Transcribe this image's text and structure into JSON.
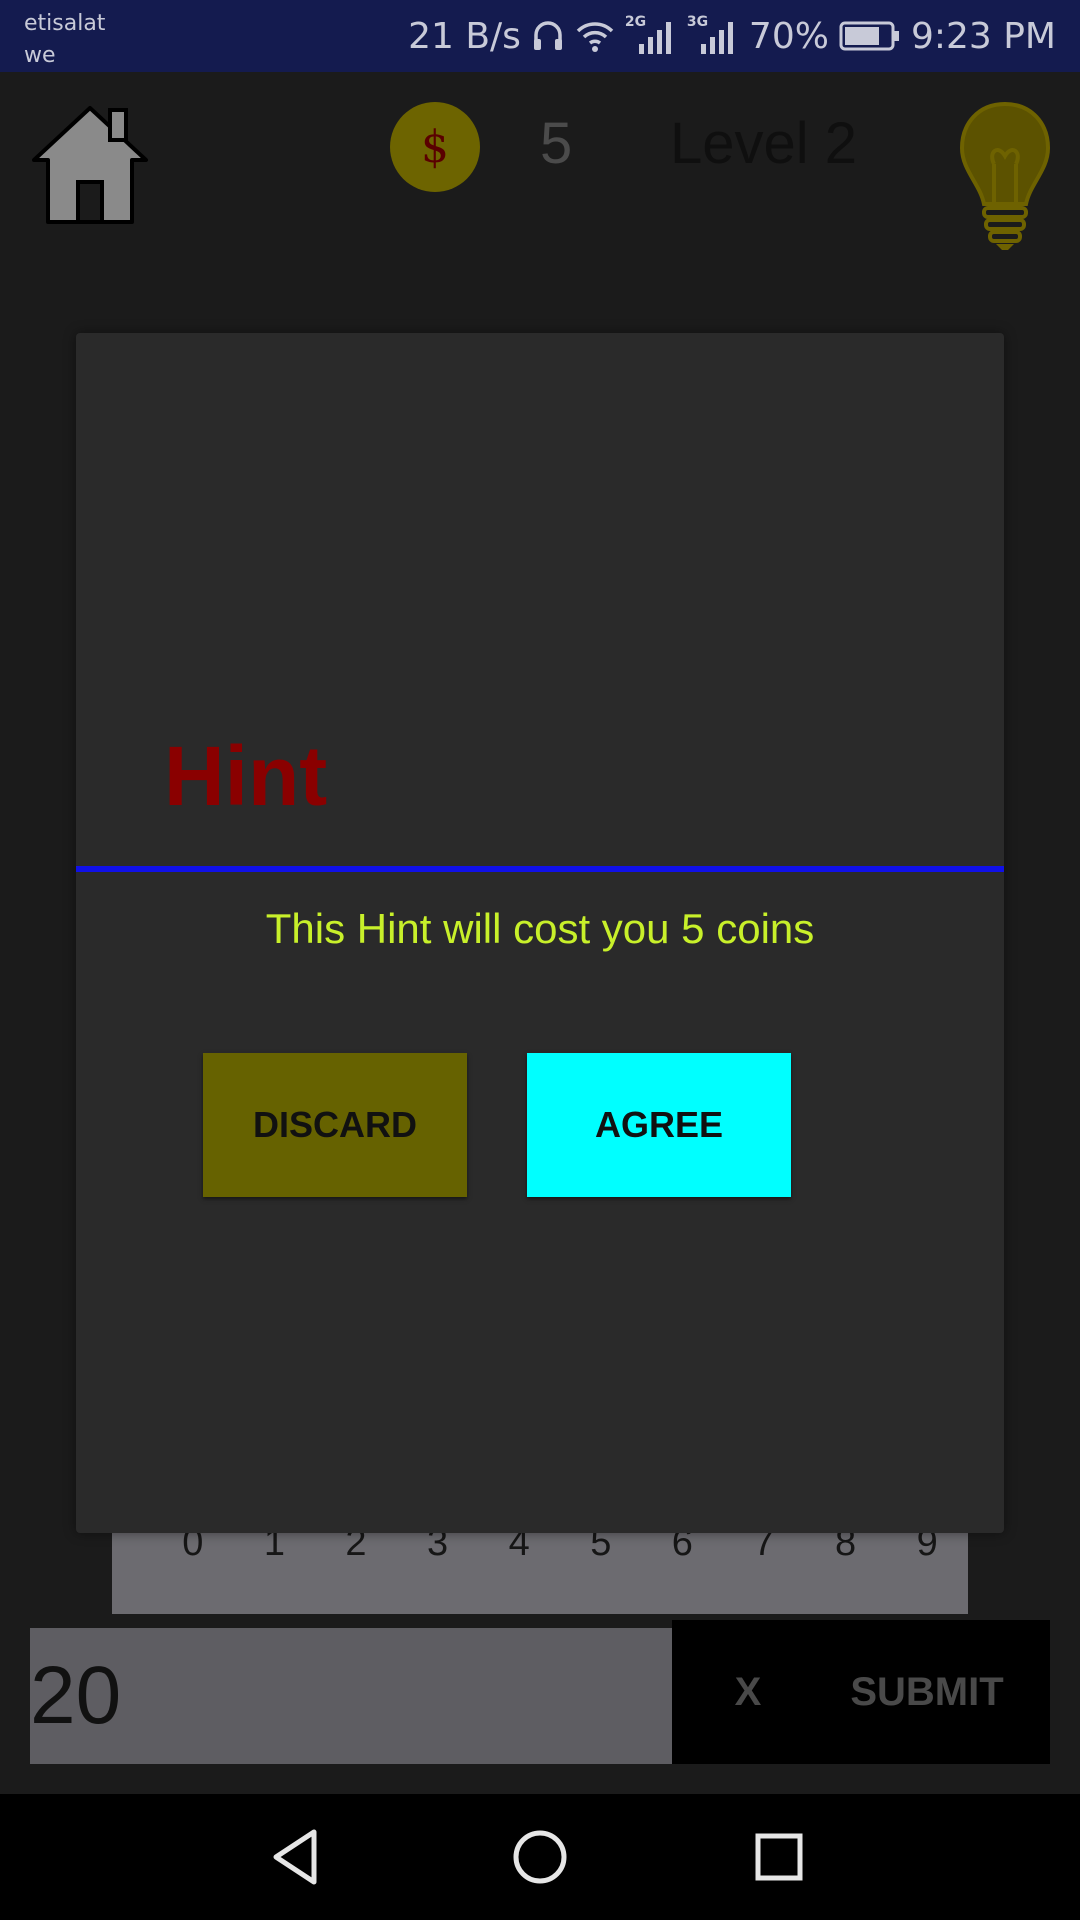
{
  "status_bar": {
    "carrier_line1": "etisalat",
    "carrier_line2": "we",
    "speed": "21 B/s",
    "net1": "2G",
    "net2": "3G",
    "battery": "70%",
    "time": "9:23 PM"
  },
  "game": {
    "coins": "5",
    "coin_symbol": "$",
    "level": "Level 2"
  },
  "dialog": {
    "title": "Hint",
    "message": "This Hint will cost you 5 coins",
    "discard_label": "DISCARD",
    "agree_label": "AGREE"
  },
  "keypad": {
    "digits": [
      "0",
      "1",
      "2",
      "3",
      "4",
      "5",
      "6",
      "7",
      "8",
      "9"
    ]
  },
  "answer": {
    "value": "20",
    "clear_label": "X",
    "submit_label": "SUBMIT"
  },
  "colors": {
    "dialog_title": "#8a0000",
    "divider": "#1010e8",
    "message": "#c8f02a",
    "discard_bg": "#666200",
    "agree_bg": "#00ffff"
  }
}
